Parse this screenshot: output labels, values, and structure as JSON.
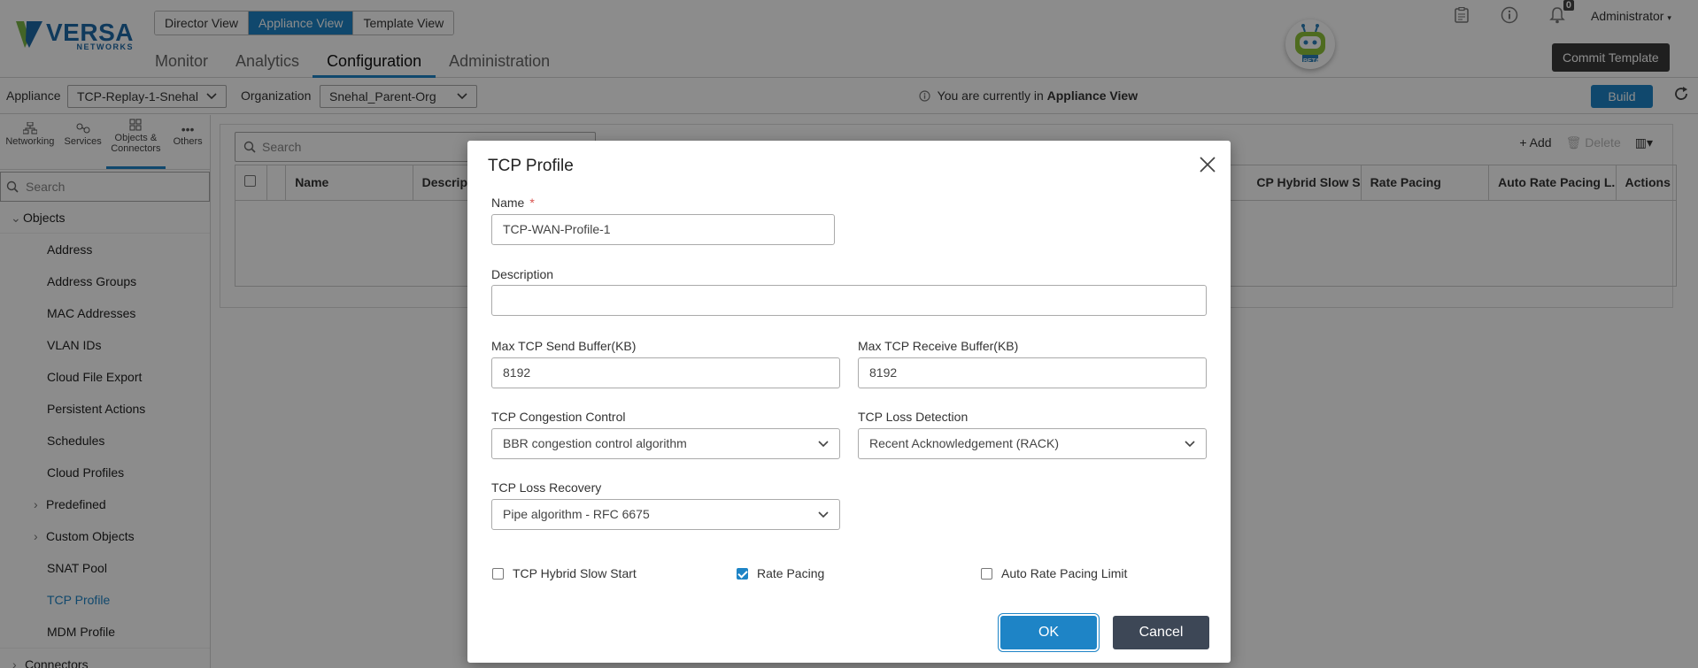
{
  "brand": {
    "name": "VERSA",
    "sub": "NETWORKS"
  },
  "view_switch": [
    "Director View",
    "Appliance View",
    "Template View"
  ],
  "main_nav": [
    "Monitor",
    "Analytics",
    "Configuration",
    "Administration"
  ],
  "bot": {
    "badge": "BETA"
  },
  "notifications": {
    "count": "0"
  },
  "user": {
    "name": "Administrator"
  },
  "commit_template": "Commit Template",
  "context": {
    "appliance_label": "Appliance",
    "appliance_value": "TCP-Replay-1-Snehal",
    "org_label": "Organization",
    "org_value": "Snehal_Parent-Org",
    "info_prefix": "You are currently in",
    "info_view": "Appliance View",
    "build": "Build"
  },
  "sidebar": {
    "tabs": [
      "Networking",
      "Services",
      "Objects & Connectors",
      "Others"
    ],
    "search_placeholder": "Search",
    "root": "Objects",
    "items": [
      "Address",
      "Address Groups",
      "MAC Addresses",
      "VLAN IDs",
      "Cloud File Export",
      "Persistent Actions",
      "Schedules",
      "Cloud Profiles",
      "Predefined",
      "Custom Objects",
      "SNAT Pool",
      "TCP Profile",
      "MDM Profile"
    ],
    "connectors": "Connectors"
  },
  "table": {
    "search_placeholder": "Search",
    "add": "Add",
    "delete": "Delete",
    "columns": [
      "Name",
      "Descrip",
      "CP Hybrid Slow S...",
      "Rate Pacing",
      "Auto Rate Pacing L...",
      "Actions"
    ]
  },
  "modal": {
    "title": "TCP Profile",
    "name_label": "Name",
    "name_value": "TCP-WAN-Profile-1",
    "desc_label": "Description",
    "desc_value": "",
    "send_label": "Max TCP Send Buffer(KB)",
    "send_value": "8192",
    "recv_label": "Max TCP Receive Buffer(KB)",
    "recv_value": "8192",
    "cc_label": "TCP Congestion Control",
    "cc_value": "BBR congestion control algorithm",
    "ld_label": "TCP Loss Detection",
    "ld_value": "Recent Acknowledgement (RACK)",
    "lr_label": "TCP Loss Recovery",
    "lr_value": "Pipe algorithm - RFC 6675",
    "hybrid_label": "TCP Hybrid Slow Start",
    "hybrid_checked": false,
    "pacing_label": "Rate Pacing",
    "pacing_checked": true,
    "auto_label": "Auto Rate Pacing Limit",
    "auto_checked": false,
    "ok": "OK",
    "cancel": "Cancel"
  }
}
